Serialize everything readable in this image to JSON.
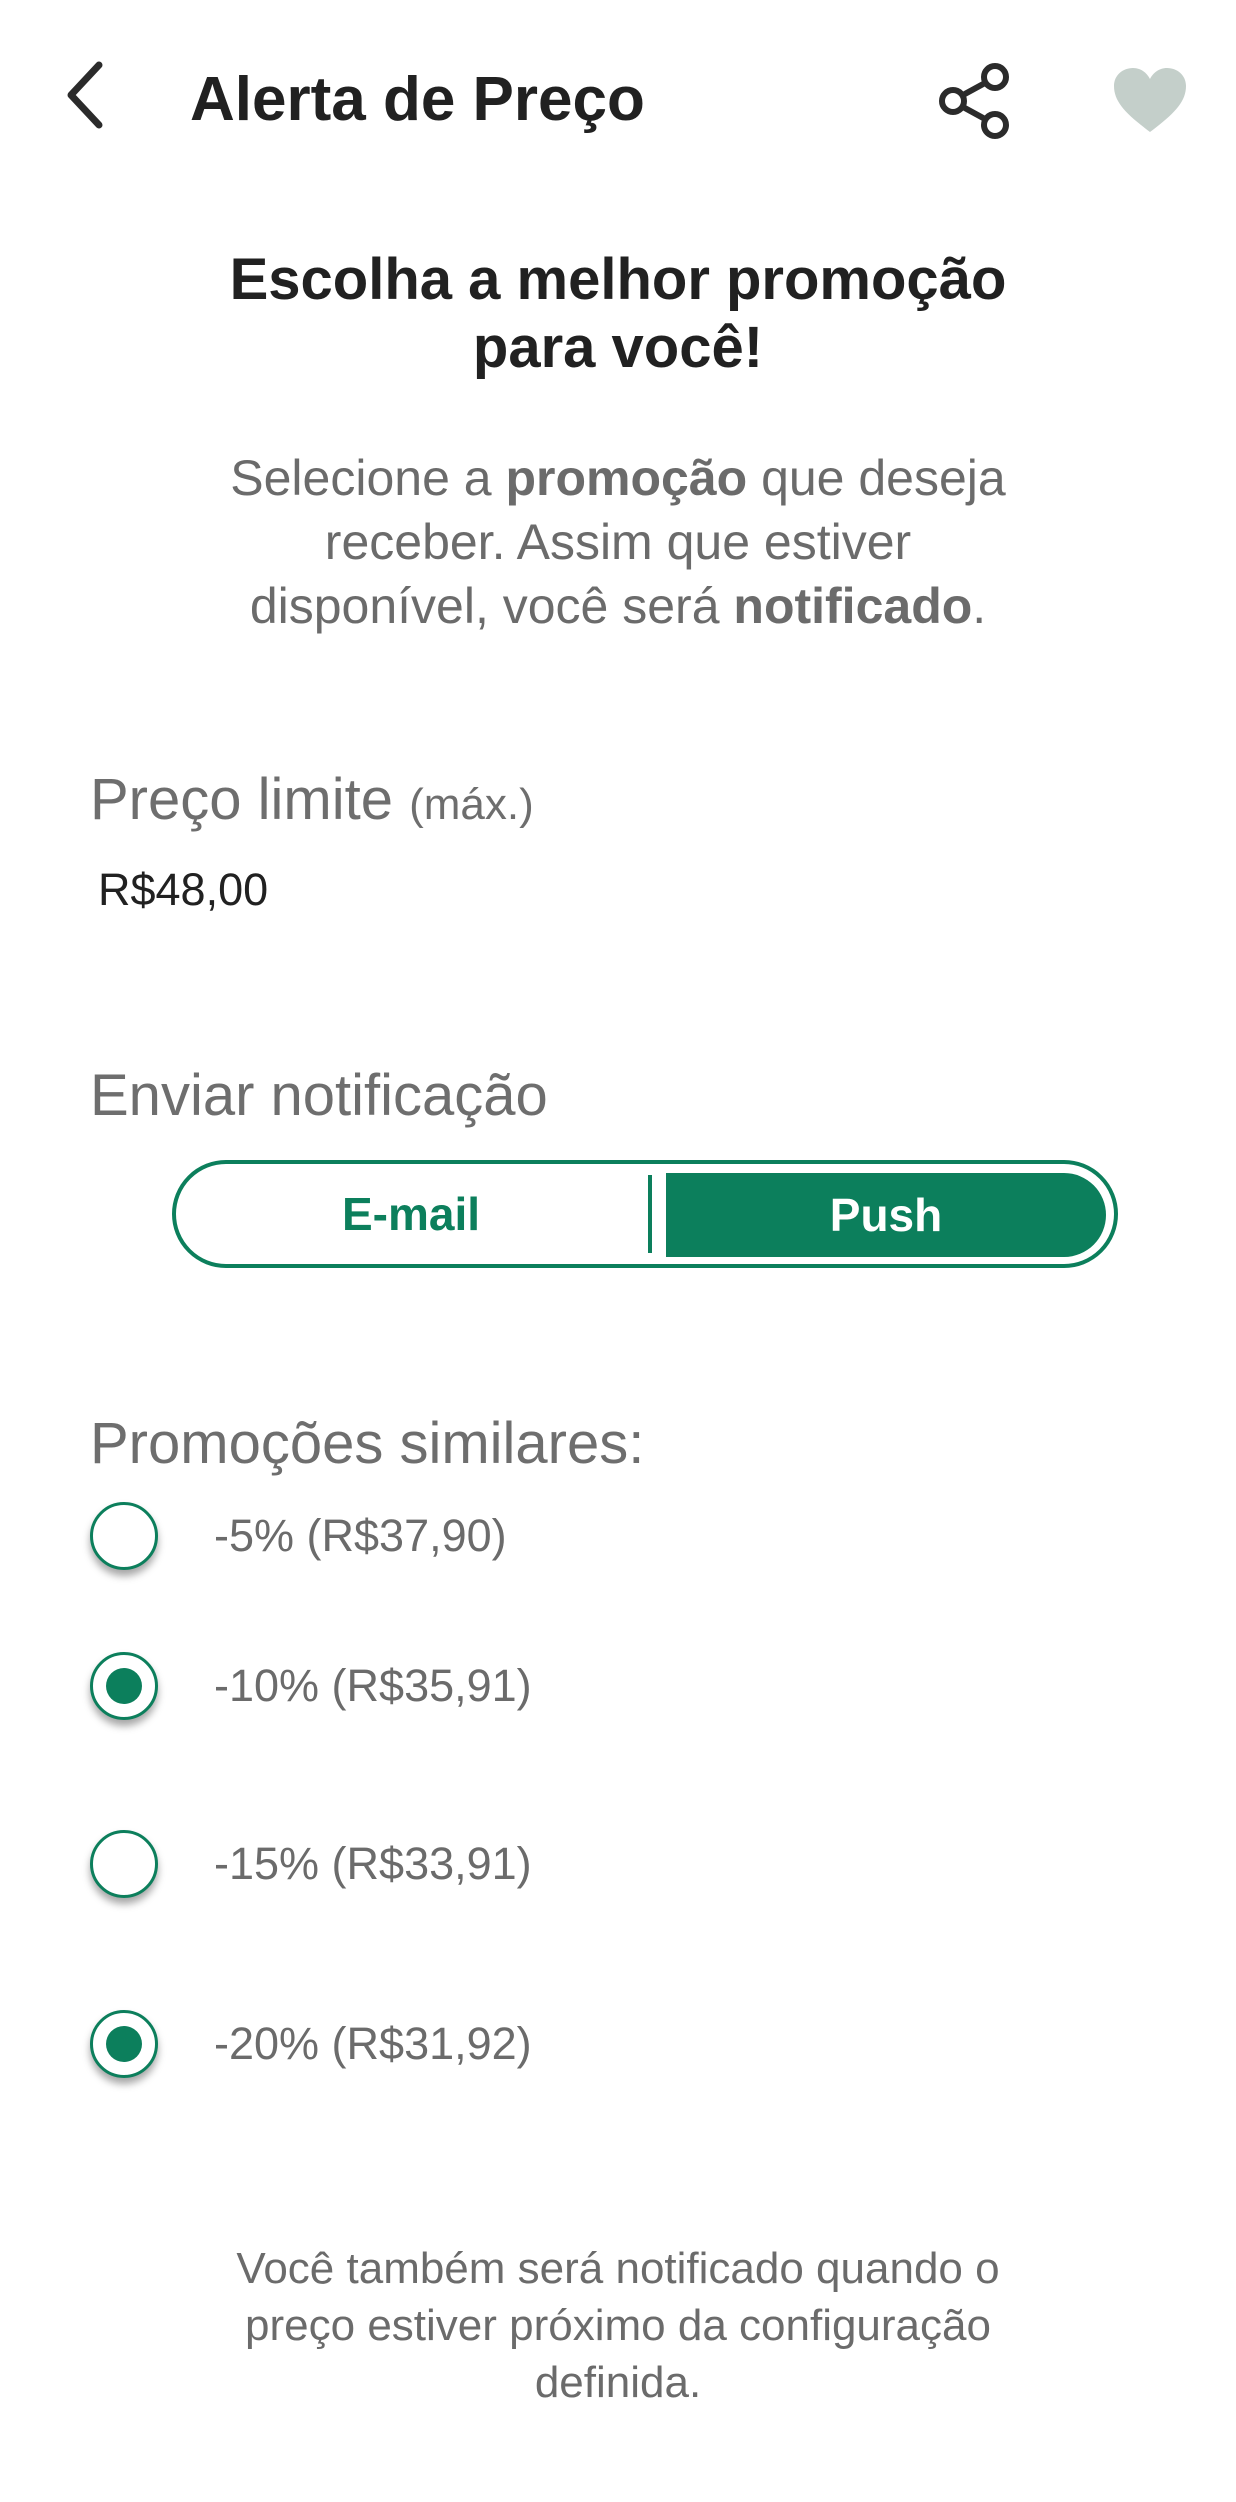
{
  "header": {
    "title": "Alerta de Preço",
    "back_icon": "chevron-left-icon",
    "share_icon": "share-icon",
    "favorite_icon": "heart-icon",
    "favorite_color": "#c4cfca"
  },
  "headline": {
    "line1": "Escolha a melhor promoção",
    "line2": "para você!"
  },
  "description": {
    "part1": "Selecione a ",
    "bold1": "promoção",
    "part2": " que deseja",
    "line2": "receber. Assim que estiver",
    "part3": "disponível, você será ",
    "bold2": "notificado",
    "part4": "."
  },
  "price_limit": {
    "label": "Preço limite",
    "label_suffix": "(máx.)",
    "value": "R$48,00"
  },
  "notification": {
    "label": "Enviar notificação",
    "options": [
      {
        "label": "E-mail",
        "selected": false
      },
      {
        "label": "Push",
        "selected": true
      }
    ]
  },
  "promotions": {
    "label": "Promoções similares:",
    "items": [
      {
        "label": "-5% (R$37,90)",
        "checked": false
      },
      {
        "label": "-10% (R$35,91)",
        "checked": true
      },
      {
        "label": "-15% (R$33,91)",
        "checked": false
      },
      {
        "label": "-20% (R$31,92)",
        "checked": true
      }
    ]
  },
  "footnote": {
    "line1": "Você também será notificado quando o",
    "line2": "preço estiver próximo da configuração",
    "line3": "definida."
  },
  "colors": {
    "accent": "#0c7f5c",
    "muted_text": "#6b6b6b"
  }
}
